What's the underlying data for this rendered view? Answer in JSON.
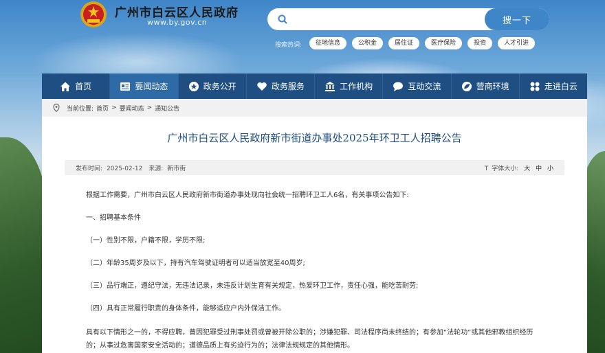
{
  "header": {
    "site_title": "广州市白云区人民政府",
    "site_url": "www.by.gov.cn"
  },
  "search": {
    "placeholder": "",
    "button_label": "搜一下",
    "hot_label": "搜索热词:",
    "hot_tags": [
      "征地信息",
      "公积金",
      "居住证",
      "医疗保险",
      "投资",
      "人才引进"
    ]
  },
  "nav": {
    "items": [
      {
        "label": "首页",
        "icon": "home-icon"
      },
      {
        "label": "要闻动态",
        "icon": "news-icon"
      },
      {
        "label": "政务公开",
        "icon": "open-icon"
      },
      {
        "label": "政务服务",
        "icon": "heart-icon"
      },
      {
        "label": "工作机构",
        "icon": "building-icon"
      },
      {
        "label": "互动交流",
        "icon": "chat-icon"
      },
      {
        "label": "营商环境",
        "icon": "leaf-icon"
      },
      {
        "label": "走进白云",
        "icon": "grid-icon"
      }
    ],
    "active_index": 1
  },
  "breadcrumb": {
    "prefix": "当前位置:",
    "items": [
      "首页",
      "要闻动态",
      "通知公告"
    ],
    "separator": ">"
  },
  "article": {
    "title": "广州市白云区人民政府新市街道办事处2025年环卫工人招聘公告",
    "publish_label": "发布时间:",
    "publish_date": "2025-02-12",
    "source_label": "来源:",
    "source": "新市街",
    "font_size_label": "字体大小:",
    "font_sizes": [
      "大",
      "中",
      "小"
    ],
    "paragraphs": [
      "根据工作需要，广州市白云区人民政府新市街道办事处现向社会统一招聘环卫工人6名，有关事项公告如下:",
      "一、招聘基本条件",
      "（一）性别不限，户籍不限，学历不限;",
      "（二）年龄35周岁及以下，持有汽车驾驶证明者可以适当放宽至40周岁;",
      "（三）品行端正，遵纪守法，无违法记录，未违反计划生育有关规定，热爱环卫工作，责任心强，能吃苦耐劳;",
      "（四）具有正常履行职责的身体条件，能够适应户内外保洁工作。",
      "具有以下情形之一的，不得应聘，曾因犯罪受过刑事处罚或曾被开除公职的；涉嫌犯罪、司法程序尚未终结的；有参加“法轮功”或其他邪教组织经历的；从事过危害国家安全活动的；道德品质上有劣迹行为的；法律法规规定的其他情形。"
    ]
  },
  "colors": {
    "nav_bg": "#1f4f82",
    "nav_active": "#2e6aa5",
    "title_color": "#1f4f82",
    "search_button": "#3f86c9"
  }
}
